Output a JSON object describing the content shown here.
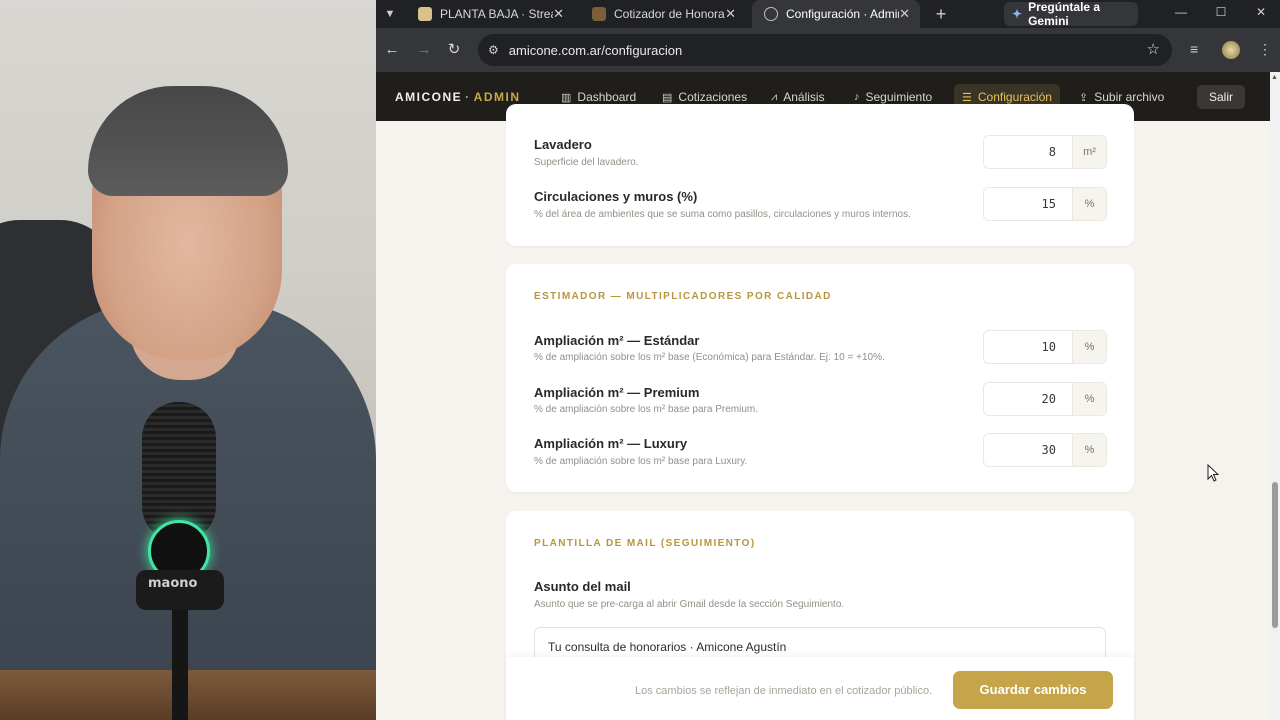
{
  "tabs": [
    {
      "title": "PLANTA BAJA · Streamin",
      "color": "#d9c28a"
    },
    {
      "title": "Cotizador de Honorario",
      "color": "#7a5f3a"
    },
    {
      "title": "Configuración · Admin",
      "color": "#9aa0a6"
    }
  ],
  "gemini_label": "Pregúntale a Gemini",
  "url": "amicone.com.ar/configuracion",
  "brand": {
    "name": "AMICONE",
    "sep": "·",
    "admin": "ADMIN"
  },
  "nav": {
    "dashboard": "Dashboard",
    "cotizaciones": "Cotizaciones",
    "analisis": "Análisis",
    "seguimiento": "Seguimiento",
    "configuracion": "Configuración",
    "subir": "Subir archivo",
    "salir": "Salir"
  },
  "card1": {
    "lavadero": {
      "label": "Lavadero",
      "help": "Superficie del lavadero.",
      "value": "8",
      "unit": "m²"
    },
    "circulaciones": {
      "label": "Circulaciones y muros (%)",
      "help": "% del área de ambientes que se suma como pasillos, circulaciones y muros internos.",
      "value": "15",
      "unit": "%"
    }
  },
  "card2": {
    "title": "ESTIMADOR — MULTIPLICADORES POR CALIDAD",
    "estandar": {
      "label": "Ampliación m² — Estándar",
      "help": "% de ampliación sobre los m² base (Económica) para Estándar. Ej: 10 = +10%.",
      "value": "10",
      "unit": "%"
    },
    "premium": {
      "label": "Ampliación m² — Premium",
      "help": "% de ampliación sobre los m² base para Premium.",
      "value": "20",
      "unit": "%"
    },
    "luxury": {
      "label": "Ampliación m² — Luxury",
      "help": "% de ampliación sobre los m² base para Luxury.",
      "value": "30",
      "unit": "%"
    }
  },
  "card3": {
    "title": "PLANTILLA DE MAIL (SEGUIMIENTO)",
    "asunto": {
      "label": "Asunto del mail",
      "help": "Asunto que se pre-carga al abrir Gmail desde la sección Seguimiento.",
      "value": "Tu consulta de honorarios · Amicone Agustín"
    }
  },
  "footer": {
    "note": "Los cambios se reflejan de inmediato en el cotizador público.",
    "save": "Guardar cambios"
  },
  "webcam": {
    "mic_brand": "maono"
  },
  "colors": {
    "accent": "#c5a44a",
    "header_bg": "#201e1b",
    "page_bg": "#f6f3ee"
  }
}
